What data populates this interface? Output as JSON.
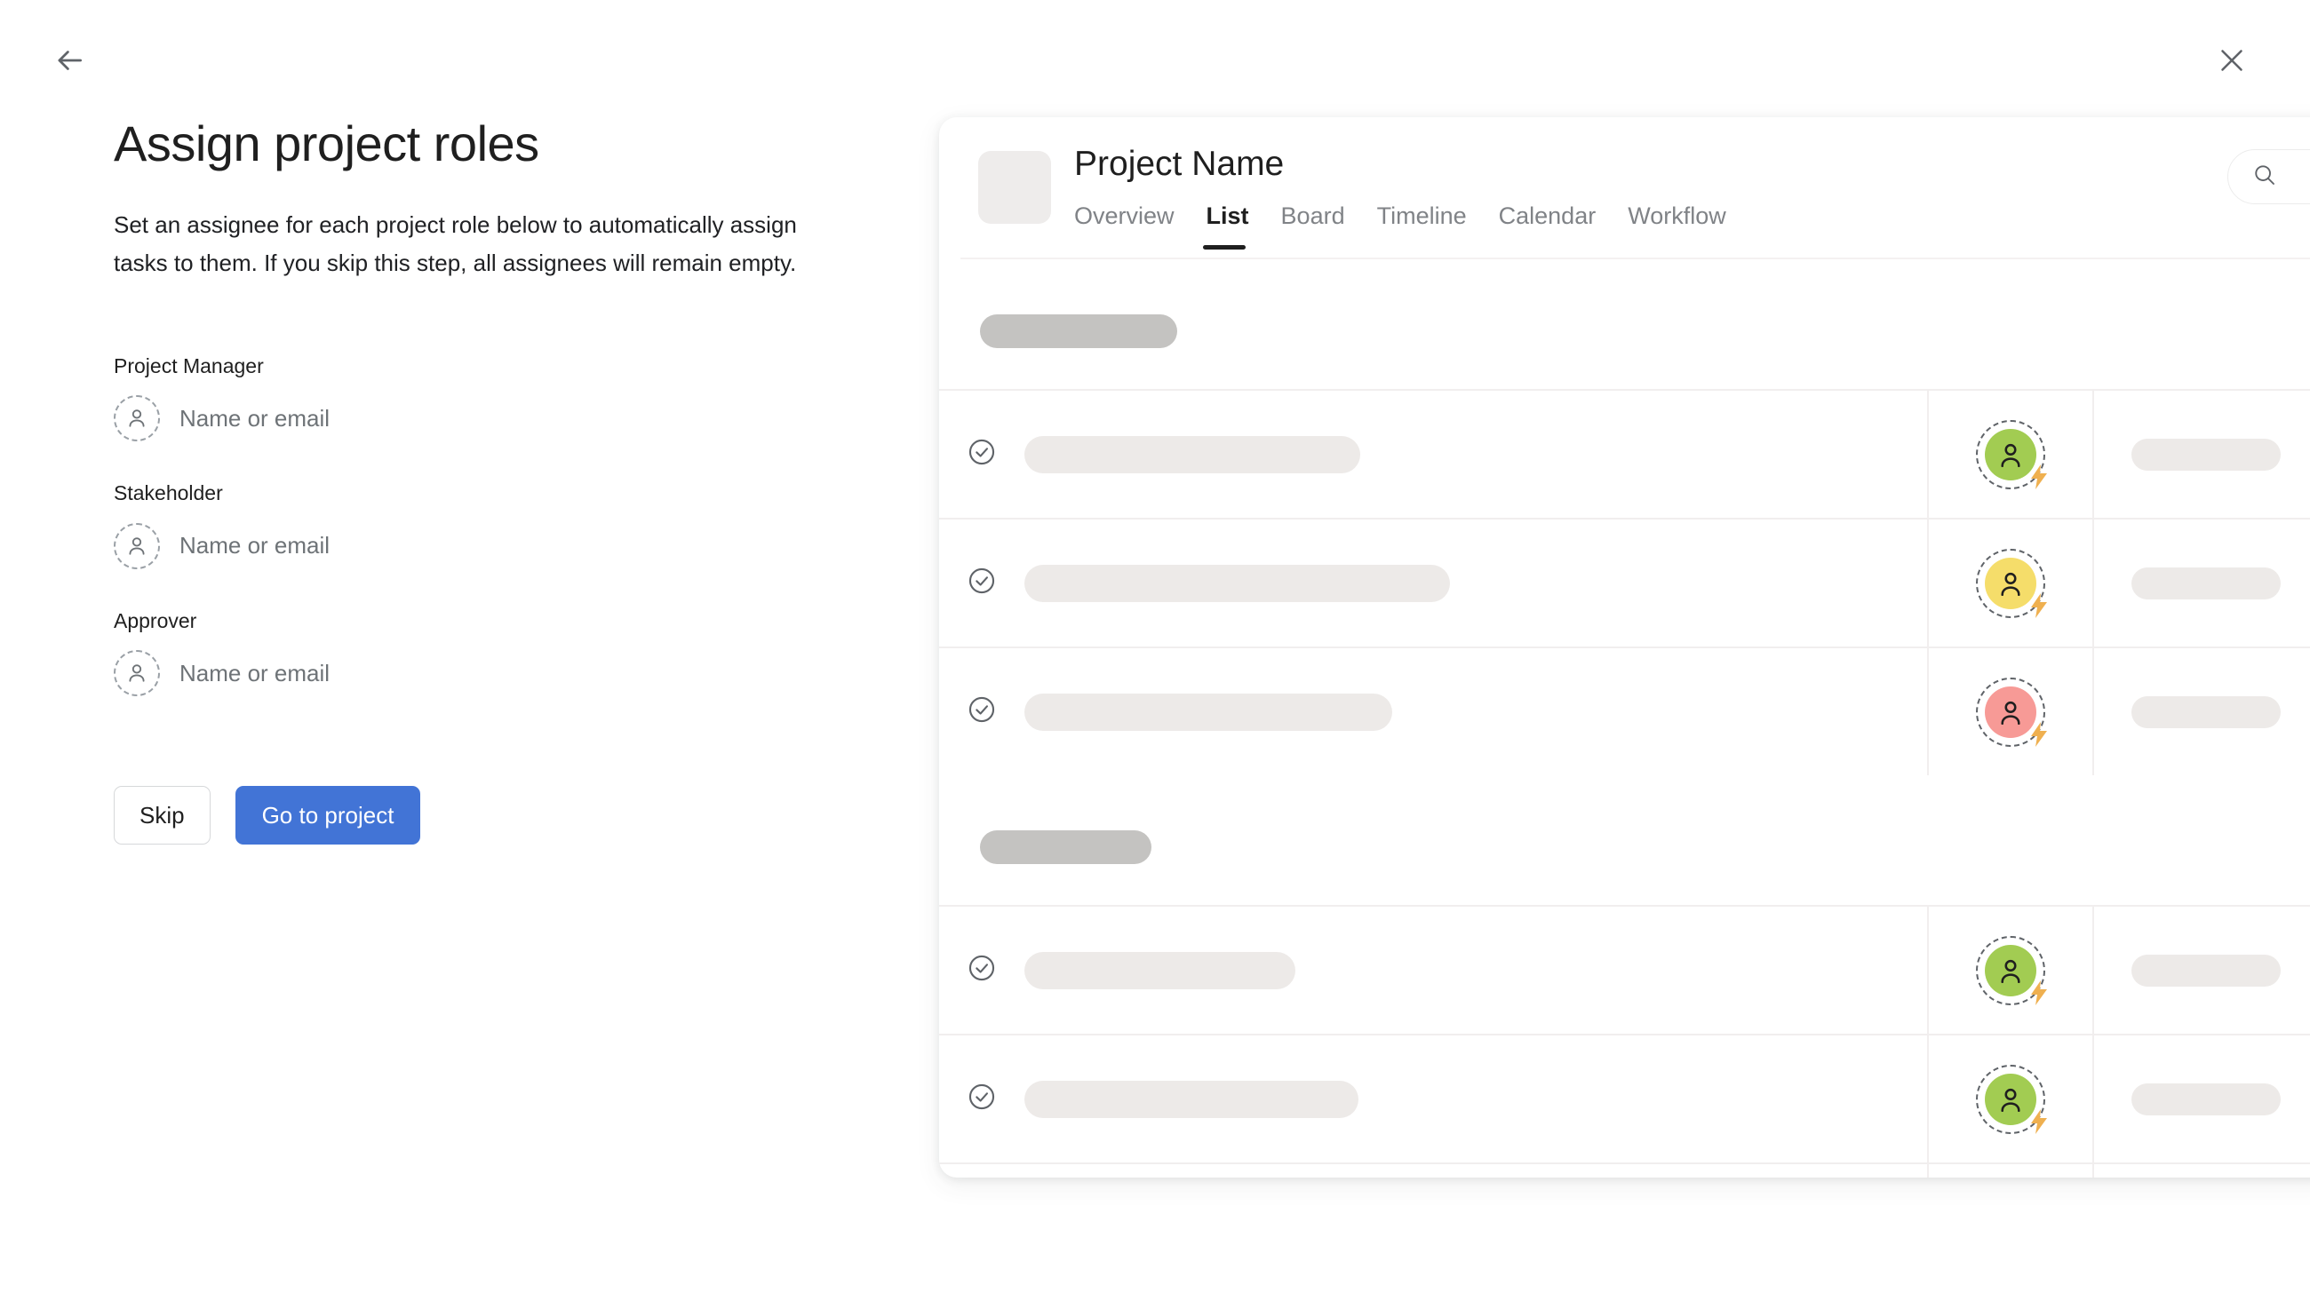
{
  "header": {
    "back_icon": "arrow-left-icon",
    "close_icon": "close-icon"
  },
  "left": {
    "title": "Assign project roles",
    "subtitle": "Set an assignee for each project role below to automatically assign tasks to them. If you skip this step, all assignees will remain empty.",
    "roles": [
      {
        "label": "Project Manager",
        "placeholder": "Name or email",
        "value": ""
      },
      {
        "label": "Stakeholder",
        "placeholder": "Name or email",
        "value": ""
      },
      {
        "label": "Approver",
        "placeholder": "Name or email",
        "value": ""
      }
    ],
    "buttons": {
      "skip": "Skip",
      "primary": "Go to project"
    },
    "colors": {
      "primary_button": "#4274d6"
    }
  },
  "preview": {
    "project_name": "Project Name",
    "tabs": [
      {
        "label": "Overview",
        "active": false
      },
      {
        "label": "List",
        "active": true
      },
      {
        "label": "Board",
        "active": false
      },
      {
        "label": "Timeline",
        "active": false
      },
      {
        "label": "Calendar",
        "active": false
      },
      {
        "label": "Workflow",
        "active": false
      }
    ],
    "search": {
      "icon": "search-icon",
      "placeholder": "",
      "value": ""
    },
    "sections": [
      {
        "header_bar_width": 222,
        "rows": [
          {
            "status_icon": "check-circle-icon",
            "title_bar_width": 378,
            "avatar_color": "#a2cc52",
            "has_bolt": true,
            "meta_bar": true
          },
          {
            "status_icon": "check-circle-icon",
            "title_bar_width": 479,
            "avatar_color": "#f5dd6a",
            "has_bolt": true,
            "meta_bar": true
          },
          {
            "status_icon": "check-circle-icon",
            "title_bar_width": 414,
            "avatar_color": "#f79a96",
            "has_bolt": true,
            "meta_bar": true
          }
        ]
      },
      {
        "header_bar_width": 193,
        "rows": [
          {
            "status_icon": "check-circle-icon",
            "title_bar_width": 305,
            "avatar_color": "#a2cc52",
            "has_bolt": true,
            "meta_bar": true
          },
          {
            "status_icon": "check-circle-icon",
            "title_bar_width": 376,
            "avatar_color": "#a2cc52",
            "has_bolt": true,
            "meta_bar": true
          },
          {
            "status_icon": "check-circle-icon",
            "title_bar_width": 441,
            "avatar_color": "#f79a96",
            "has_bolt": true,
            "meta_bar": true
          }
        ]
      }
    ]
  }
}
